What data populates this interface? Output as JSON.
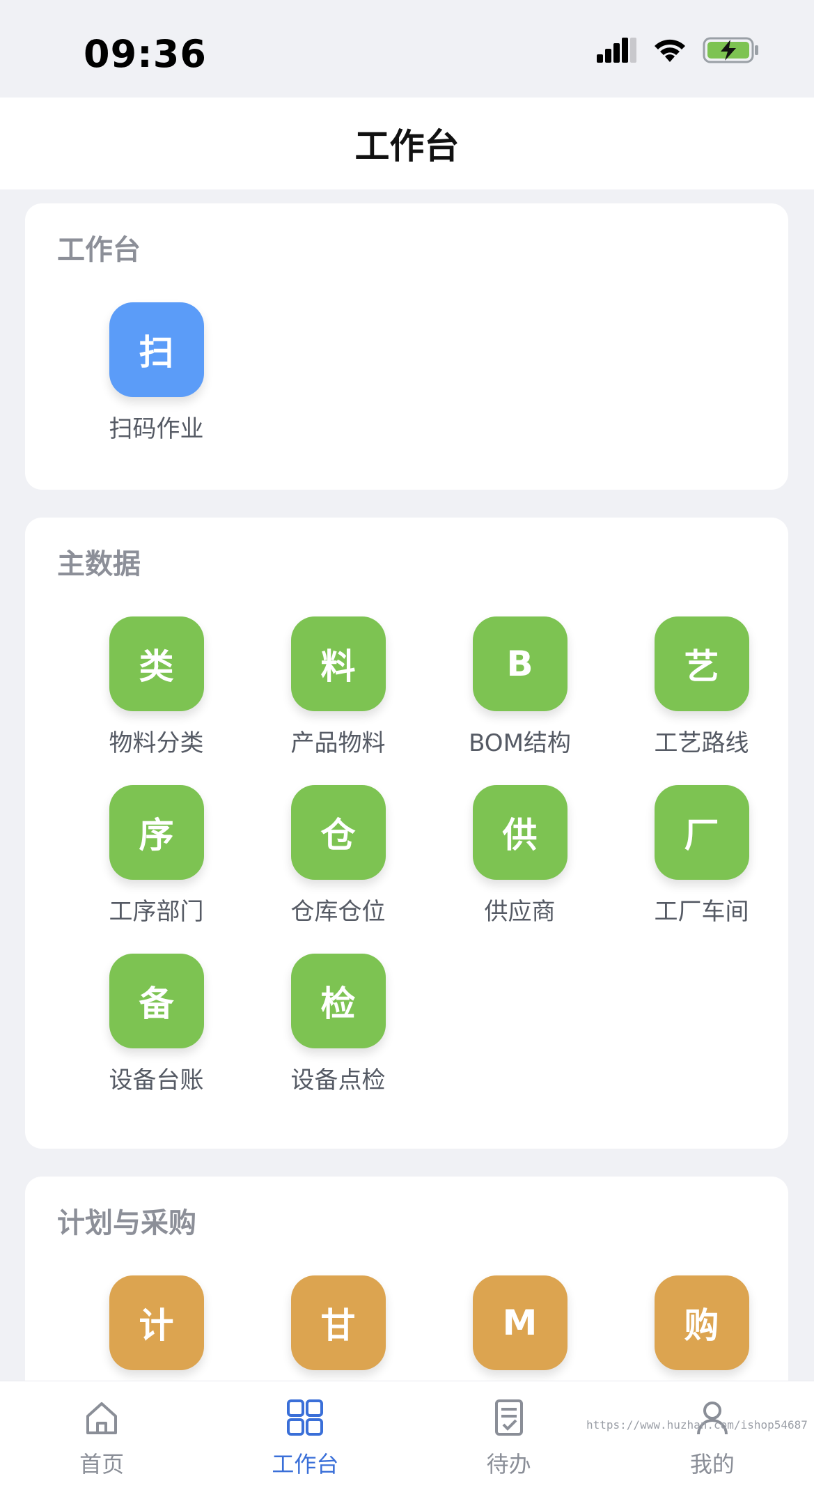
{
  "status_bar": {
    "time": "09:36",
    "icons": [
      "cellular-icon",
      "wifi-icon",
      "battery-charging-icon"
    ],
    "battery_color": "#7dc352"
  },
  "header": {
    "title": "工作台"
  },
  "sections": [
    {
      "title": "工作台",
      "color": "#5b9cf8",
      "items": [
        {
          "glyph": "扫",
          "label": "扫码作业"
        }
      ]
    },
    {
      "title": "主数据",
      "color": "#7dc352",
      "items": [
        {
          "glyph": "类",
          "label": "物料分类"
        },
        {
          "glyph": "料",
          "label": "产品物料"
        },
        {
          "glyph": "B",
          "label": "BOM结构"
        },
        {
          "glyph": "艺",
          "label": "工艺路线"
        },
        {
          "glyph": "序",
          "label": "工序部门"
        },
        {
          "glyph": "仓",
          "label": "仓库仓位"
        },
        {
          "glyph": "供",
          "label": "供应商"
        },
        {
          "glyph": "厂",
          "label": "工厂车间"
        },
        {
          "glyph": "备",
          "label": "设备台账"
        },
        {
          "glyph": "检",
          "label": "设备点检"
        }
      ]
    },
    {
      "title": "计划与采购",
      "color": "#dca450",
      "items": [
        {
          "glyph": "计",
          "label": ""
        },
        {
          "glyph": "甘",
          "label": ""
        },
        {
          "glyph": "M",
          "label": ""
        },
        {
          "glyph": "购",
          "label": ""
        }
      ]
    }
  ],
  "tabbar": {
    "active_color": "#3a6fd8",
    "tabs": [
      {
        "label": "首页",
        "icon": "home-icon"
      },
      {
        "label": "工作台",
        "icon": "grid-icon"
      },
      {
        "label": "待办",
        "icon": "todo-icon"
      },
      {
        "label": "我的",
        "icon": "user-icon"
      }
    ]
  },
  "watermark": "https://www.huzhan.com/ishop54687"
}
